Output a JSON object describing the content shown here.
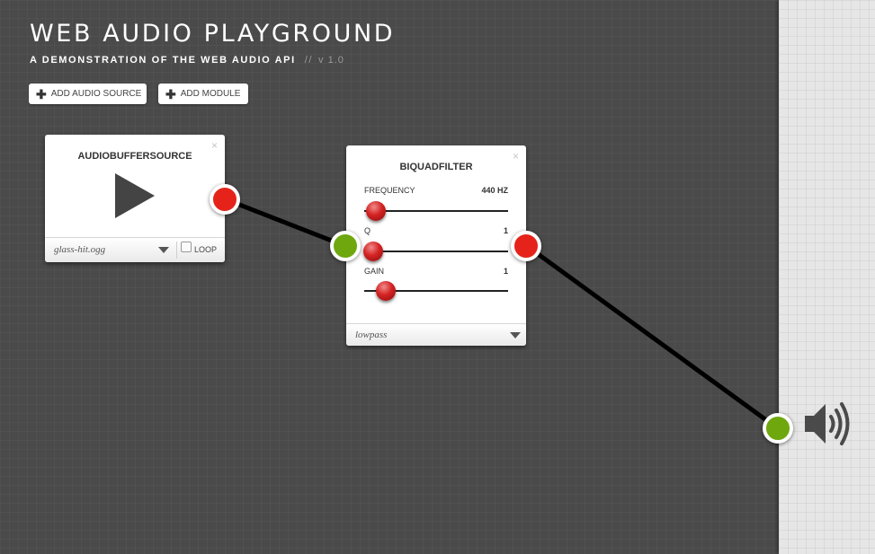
{
  "app": {
    "title": "WEB AUDIO PLAYGROUND",
    "subtitle": "A DEMONSTRATION OF THE WEB AUDIO API",
    "separator": "//",
    "version": "v 1.0"
  },
  "toolbar": {
    "add_source_label": "ADD AUDIO SOURCE",
    "add_module_label": "ADD MODULE",
    "plus_icon": "plus-icon"
  },
  "modules": {
    "source": {
      "title": "AUDIOBUFFERSOURCE",
      "close": "×",
      "file": "glass-hit.ogg",
      "loop_label": "LOOP",
      "loop_checked": false,
      "play_icon": "play-icon"
    },
    "filter": {
      "title": "BIQUADFILTER",
      "close": "×",
      "type": "lowpass",
      "params": {
        "frequency": {
          "label": "FREQUENCY",
          "value": "440 HZ",
          "knob_fraction": 0.08
        },
        "q": {
          "label": "Q",
          "value": "1",
          "knob_fraction": 0.06
        },
        "gain": {
          "label": "GAIN",
          "value": "1",
          "knob_fraction": 0.15
        }
      }
    }
  },
  "output": {
    "icon": "speaker-icon"
  },
  "colors": {
    "background": "#4a4a4a",
    "output_panel": "#e6e6e6",
    "port_out": "#e5231a",
    "port_in": "#6fa70f",
    "cable": "#000000",
    "slider_knob": "#d42222"
  }
}
